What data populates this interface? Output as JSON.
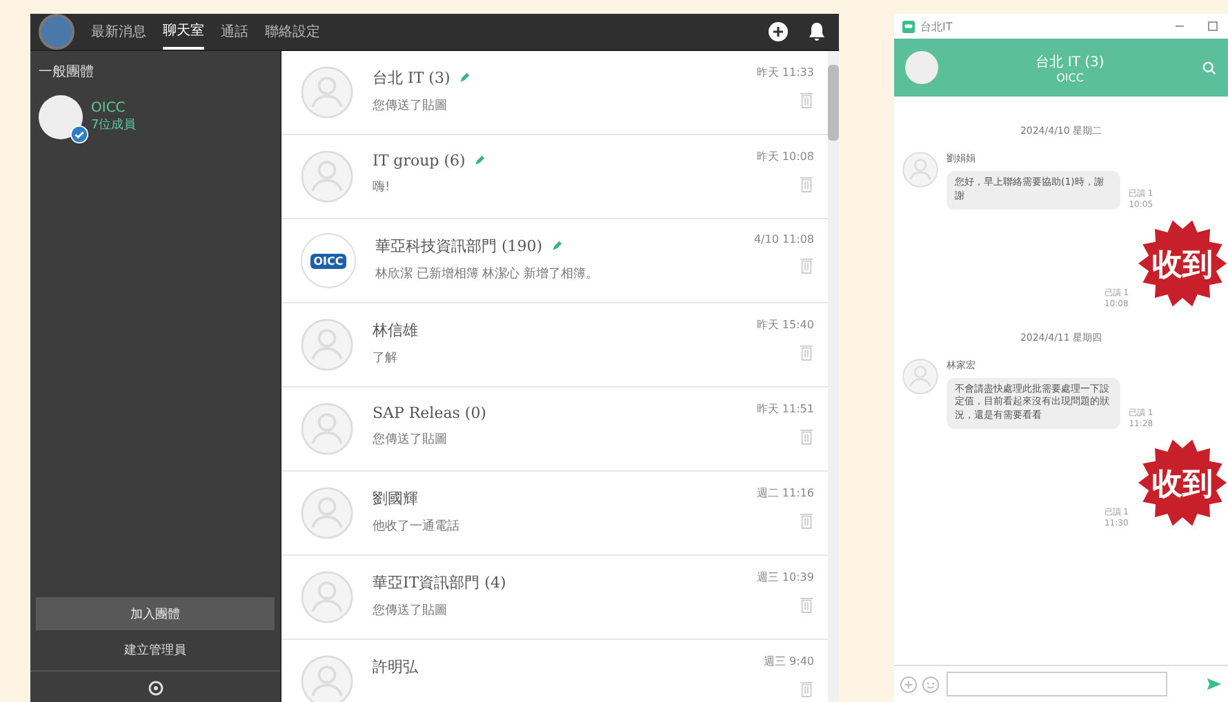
{
  "main_app": {
    "tabs": [
      {
        "label": "最新消息",
        "selected": false
      },
      {
        "label": "聊天室",
        "selected": true
      },
      {
        "label": "通話",
        "selected": false
      },
      {
        "label": "聯絡設定",
        "selected": false
      }
    ],
    "sidebar": {
      "heading": "一般團體",
      "groups": [
        {
          "name": "OICC",
          "members": "7位成員",
          "verified": true,
          "selected": true
        }
      ],
      "join_button": "加入團體",
      "manage_link": "建立管理員"
    },
    "chats": [
      {
        "name": "台北 IT (3)",
        "preview": "您傳送了貼圖",
        "time": "昨天 11:33",
        "edit_mark": true,
        "kind": "person"
      },
      {
        "name": "IT group (6)",
        "preview": "嗨!",
        "time": "昨天 10:08",
        "edit_mark": true,
        "kind": "person"
      },
      {
        "name": "華亞科技資訊部門 (190)",
        "preview": "林欣潔 已新增相簿 林潔心 新增了相簿。",
        "time": "4/10 11:08",
        "edit_mark": true,
        "kind": "logo",
        "logo_text": "OICC"
      },
      {
        "name": "林信雄",
        "preview": "了解",
        "time": "昨天 15:40",
        "edit_mark": false,
        "kind": "person"
      },
      {
        "name": "SAP Releas (0)",
        "preview": "您傳送了貼圖",
        "time": "昨天 11:51",
        "edit_mark": false,
        "kind": "person"
      },
      {
        "name": "劉國輝",
        "preview": "他收了一通電話",
        "time": "週二 11:16",
        "edit_mark": false,
        "kind": "person"
      },
      {
        "name": "華亞IT資訊部門 (4)",
        "preview": "您傳送了貼圖",
        "time": "週三 10:39",
        "edit_mark": false,
        "kind": "person"
      },
      {
        "name": "許明弘",
        "time": "週三 9:40",
        "edit_mark": false,
        "kind": "person"
      }
    ]
  },
  "chat_window": {
    "title": "台北IT",
    "header_title": "台北 IT (3)",
    "header_subtitle": "OICC",
    "messages": [
      {
        "kind": "date",
        "text": "2024/4/10 星期二"
      },
      {
        "kind": "text",
        "sender": "劉娟娟",
        "text": "您好，早上聯絡需要協助(1)時，謝謝",
        "read": "已讀 1",
        "time": "10:05"
      },
      {
        "kind": "sticker",
        "text": "收到",
        "read": "已讀 1",
        "time": "10:08"
      },
      {
        "kind": "date",
        "text": "2024/4/11 星期四"
      },
      {
        "kind": "text",
        "sender": "林家宏",
        "text": "不會請盡快處理此批需要處理一下設定值，目前看起來沒有出現問題的狀況，還是有需要看看",
        "read": "已讀 1",
        "time": "11:28"
      },
      {
        "kind": "sticker",
        "text": "收到",
        "read": "已讀 1",
        "time": "11:30"
      }
    ]
  }
}
